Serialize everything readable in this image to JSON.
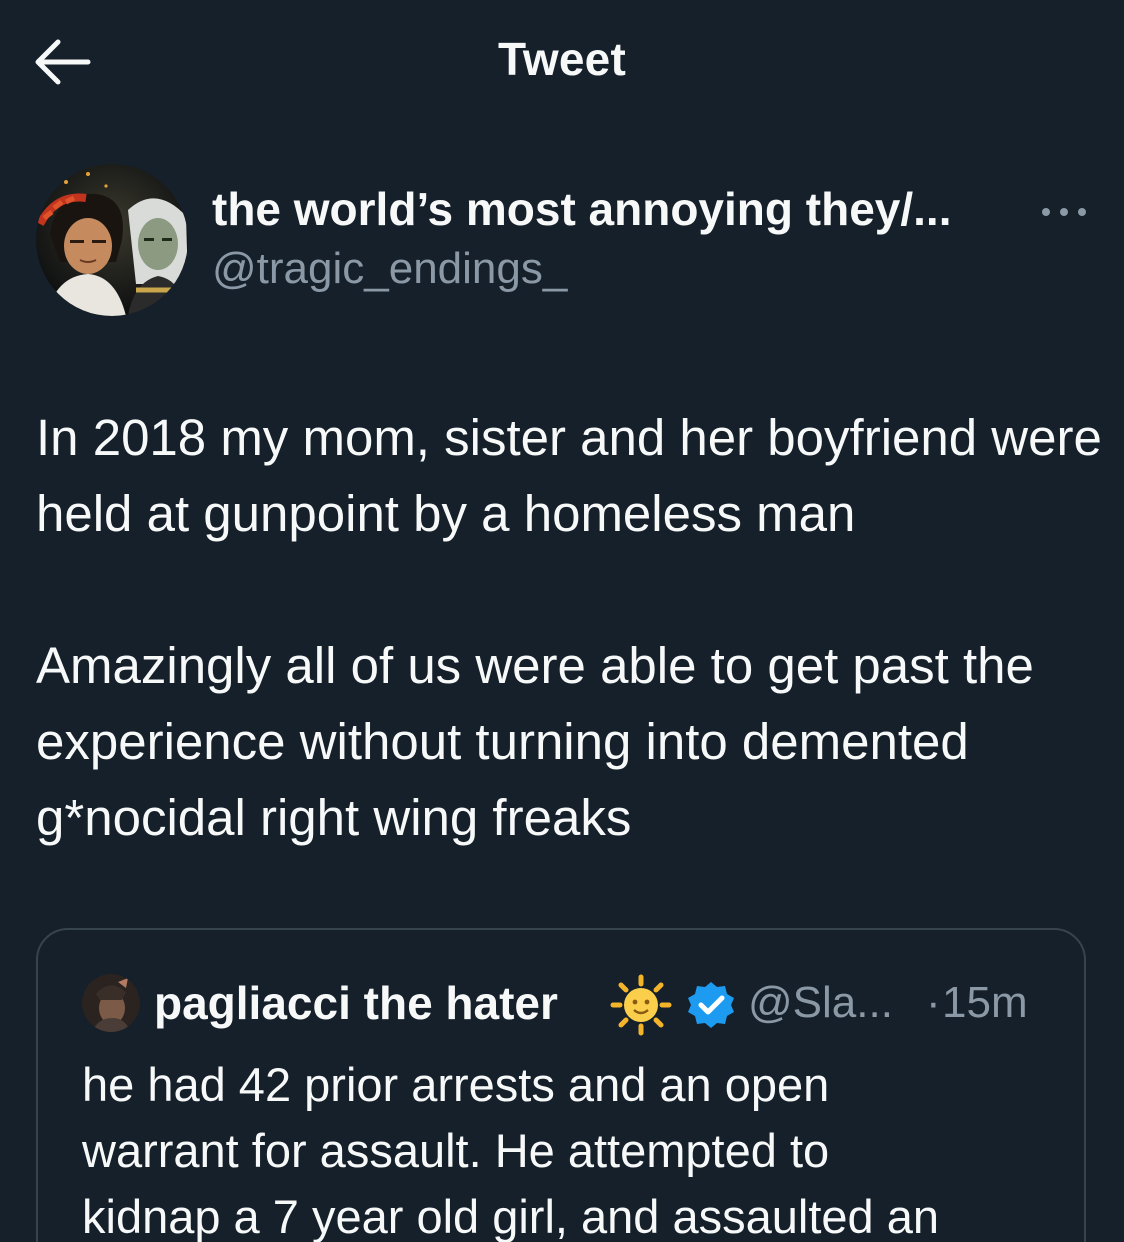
{
  "header": {
    "title": "Tweet",
    "back_icon": "arrow-left-icon"
  },
  "author": {
    "display_name": "the world’s most annoying they/...",
    "handle": "@tragic_endings_",
    "more_icon": "more-horizontal-icon"
  },
  "tweet": {
    "paragraphs": [
      "In 2018 my mom, sister and her boyfriend were held at gunpoint by a homeless man",
      "Amazingly all of us were able to get past the experience without turning into demented g*nocidal right wing freaks"
    ]
  },
  "quoted_tweet": {
    "display_name": "pagliacci the hater",
    "emoji_icon": "sun-with-face-icon",
    "verified_icon": "verified-badge-icon",
    "handle": "@Sla...",
    "separator": "·",
    "time": "15m",
    "lines": [
      "he had 42 prior arrests and an open",
      "warrant for assault. He attempted to",
      "kidnap a 7 year old girl, and assaulted an"
    ]
  },
  "colors": {
    "background": "#15202b",
    "text_primary": "#f7f9f9",
    "text_secondary": "#8b98a5",
    "border": "#38444d",
    "verified": "#1d9bf0"
  }
}
